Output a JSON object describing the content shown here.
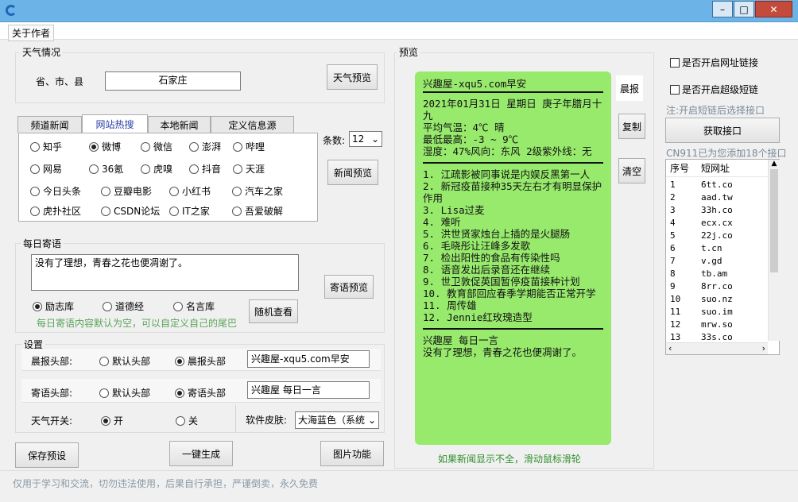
{
  "menu": {
    "about": "关于作者"
  },
  "weather": {
    "title": "天气情况",
    "region_label": "省、市、县",
    "region_value": "石家庄",
    "preview_btn": "天气预览"
  },
  "news": {
    "tabs": [
      "频道新闻",
      "网站热搜",
      "本地新闻",
      "定义信息源"
    ],
    "active_tab": 1,
    "count_label": "条数:",
    "count_value": "12",
    "preview_btn": "新闻预览",
    "sources": [
      {
        "label": "知乎",
        "on": false
      },
      {
        "label": "微博",
        "on": true
      },
      {
        "label": "微信",
        "on": false
      },
      {
        "label": "澎湃",
        "on": false
      },
      {
        "label": "哔哩",
        "on": false
      },
      {
        "label": "网易",
        "on": false
      },
      {
        "label": "36氪",
        "on": false
      },
      {
        "label": "虎嗅",
        "on": false
      },
      {
        "label": "抖音",
        "on": false
      },
      {
        "label": "天涯",
        "on": false
      },
      {
        "label": "今日头条",
        "on": false
      },
      {
        "label": "豆瓣电影",
        "on": false
      },
      {
        "label": "小红书",
        "on": false
      },
      {
        "label": "汽车之家",
        "on": false
      },
      {
        "label": "虎扑社区",
        "on": false
      },
      {
        "label": "CSDN论坛",
        "on": false
      },
      {
        "label": "IT之家",
        "on": false
      },
      {
        "label": "吾爱破解",
        "on": false
      }
    ]
  },
  "daily": {
    "title": "每日寄语",
    "text": "没有了理想，青春之花也便凋谢了。",
    "preview_btn": "寄语预览",
    "libs": [
      {
        "label": "励志库",
        "on": true
      },
      {
        "label": "道德经",
        "on": false
      },
      {
        "label": "名言库",
        "on": false
      }
    ],
    "random_btn": "随机查看",
    "hint": "每日寄语内容默认为空，可以自定义自己的尾巴"
  },
  "settings": {
    "title": "设置",
    "morning_label": "晨报头部:",
    "morning_default": "默认头部",
    "morning_custom": "晨报头部",
    "morning_value": "兴趣屋-xqu5.com早安",
    "quote_label": "寄语头部:",
    "quote_default": "默认头部",
    "quote_custom": "寄语头部",
    "quote_value": "兴趣屋 每日一言",
    "weather_switch_label": "天气开关:",
    "on_label": "开",
    "off_label": "关",
    "skin_label": "软件皮肤:",
    "skin_value": "大海蓝色（系统"
  },
  "buttons": {
    "save": "保存预设",
    "generate": "一键生成",
    "image": "图片功能"
  },
  "preview": {
    "title": "预览",
    "header": "兴趣屋-xqu5.com早安",
    "date": "2021年01月31日  星期日  庚子年腊月十九",
    "temp_avg": "平均气温：4℃ 晴",
    "temp_range": "最低最高：-3 ~ 9℃",
    "humidity": "湿度：47%风向：东风 2级紫外线：无",
    "items": [
      "1. 江疏影被同事说是内娱反黑第一人",
      "2. 新冠疫苗接种35天左右才有明显保护作用",
      "3. Lisa过麦",
      "4. 难听",
      "5. 洪世贤家烛台上插的是火腿肠",
      "6. 毛晓彤让汪峰多发歌",
      "7. 检出阳性的食品有传染性吗",
      "8. 语音发出后录音还在继续",
      "9. 世卫敦促英国暂停疫苗接种计划",
      "10. 教育部回应春季学期能否正常开学",
      "11. 周传雄",
      "12. Jennie红玫瑰造型"
    ],
    "quote_header": "兴趣屋 每日一言",
    "quote_text": "没有了理想，青春之花也便凋谢了。",
    "scroll_hint": "如果新闻显示不全，滑动鼠标滑轮"
  },
  "side": {
    "morning": "晨报",
    "copy": "复制",
    "clear": "清空"
  },
  "right": {
    "link_check": "是否开启网址链接",
    "short_check": "是否开启超级短链",
    "note": "注:开启短链后选择接口",
    "get_btn": "获取接口",
    "cn911": "CN911已为您添加18个接口",
    "col_index": "序号",
    "col_link": "短网址",
    "rows": [
      [
        "1",
        "6tt.co"
      ],
      [
        "2",
        "aad.tw"
      ],
      [
        "3",
        "33h.co"
      ],
      [
        "4",
        "ecx.cx"
      ],
      [
        "5",
        "22j.co"
      ],
      [
        "6",
        "t.cn"
      ],
      [
        "7",
        "v.gd"
      ],
      [
        "8",
        "tb.am"
      ],
      [
        "9",
        "8rr.co"
      ],
      [
        "10",
        "suo.nz"
      ],
      [
        "11",
        "suo.im"
      ],
      [
        "12",
        "mrw.so"
      ],
      [
        "13",
        "33s.co"
      ]
    ]
  },
  "footer": "仅用于学习和交流，切勿违法使用，后果自行承担，严谨倒卖，永久免费"
}
